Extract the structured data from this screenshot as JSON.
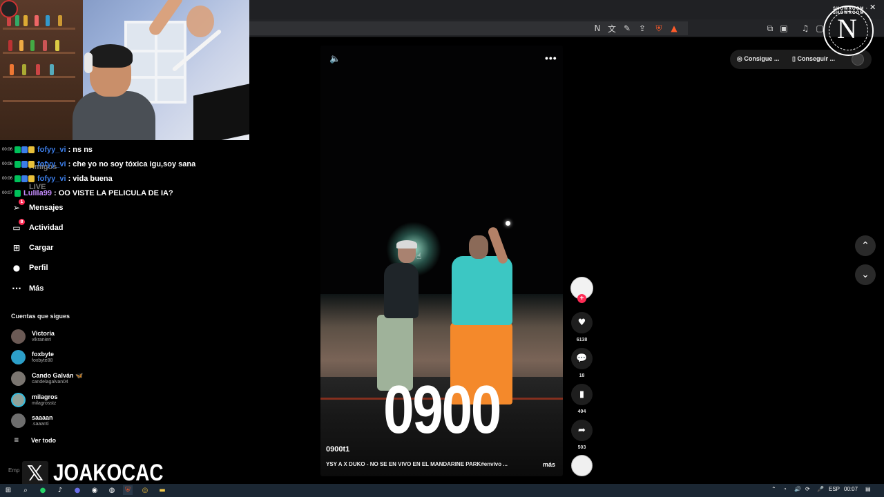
{
  "chat": {
    "lines": [
      {
        "time": "00:06",
        "user": "fofyy_vi",
        "message": ": ns ns",
        "user_color": "#3b7de8"
      },
      {
        "time": "00:06",
        "user": "fofyy_vi",
        "message": ": che yo no soy tóxica igu,soy sana",
        "user_color": "#3b7de8"
      },
      {
        "time": "00:06",
        "user": "fofyy_vi",
        "message": ": vida buena",
        "user_color": "#3b7de8"
      },
      {
        "time": "00:07",
        "user": "Lulila99",
        "message": ": OO VISTE LA PELICULA DE IA?",
        "user_color": "#c58cff"
      }
    ]
  },
  "nav": {
    "ghost_items": [
      "Amigos",
      "LIVE"
    ],
    "items": [
      {
        "label": "Mensajes",
        "icon": "send-icon",
        "badge": "1"
      },
      {
        "label": "Actividad",
        "icon": "inbox-icon",
        "badge": "8"
      },
      {
        "label": "Cargar",
        "icon": "upload-icon"
      },
      {
        "label": "Perfil",
        "icon": "profile-icon"
      },
      {
        "label": "Más",
        "icon": "more-icon"
      }
    ]
  },
  "following": {
    "title": "Cuentas que sigues",
    "accounts": [
      {
        "name": "Victoria",
        "handle": "vikranieri"
      },
      {
        "name": "foxbyte",
        "handle": "foxbyte88"
      },
      {
        "name": "Cando Galván 🦋",
        "handle": "candelagalvan04"
      },
      {
        "name": "milagros",
        "handle": "milagrosstz"
      },
      {
        "name": "saaaan",
        "handle": ".saaanti"
      }
    ],
    "see_all": "Ver todo"
  },
  "footer_text": "Emp",
  "watermark": {
    "x_symbol": "𝕏",
    "name": "JOAKOCAC"
  },
  "video": {
    "big_text": "0900",
    "author": "0900t1",
    "caption": "YSY A X DUKO - NO SE EN VIVO EN EL MANDARINE PARK#envivo ...",
    "more": "más",
    "menu": "•••",
    "mute_icon": "🔈"
  },
  "actions": {
    "plus": "+",
    "likes": "6138",
    "comments": "18",
    "saves": "494",
    "shares": "503"
  },
  "top_pills": {
    "coins": "Consigue ...",
    "app": "Conseguir ..."
  },
  "logo": {
    "letter": "N",
    "ring_text": "SHOWROOM · SHOWROOM"
  },
  "taskbar": {
    "language": "ESP",
    "time": "00:07"
  },
  "colors": {
    "accent": "#fe2c55",
    "background": "#000000",
    "taskbar": "#1b2733"
  }
}
